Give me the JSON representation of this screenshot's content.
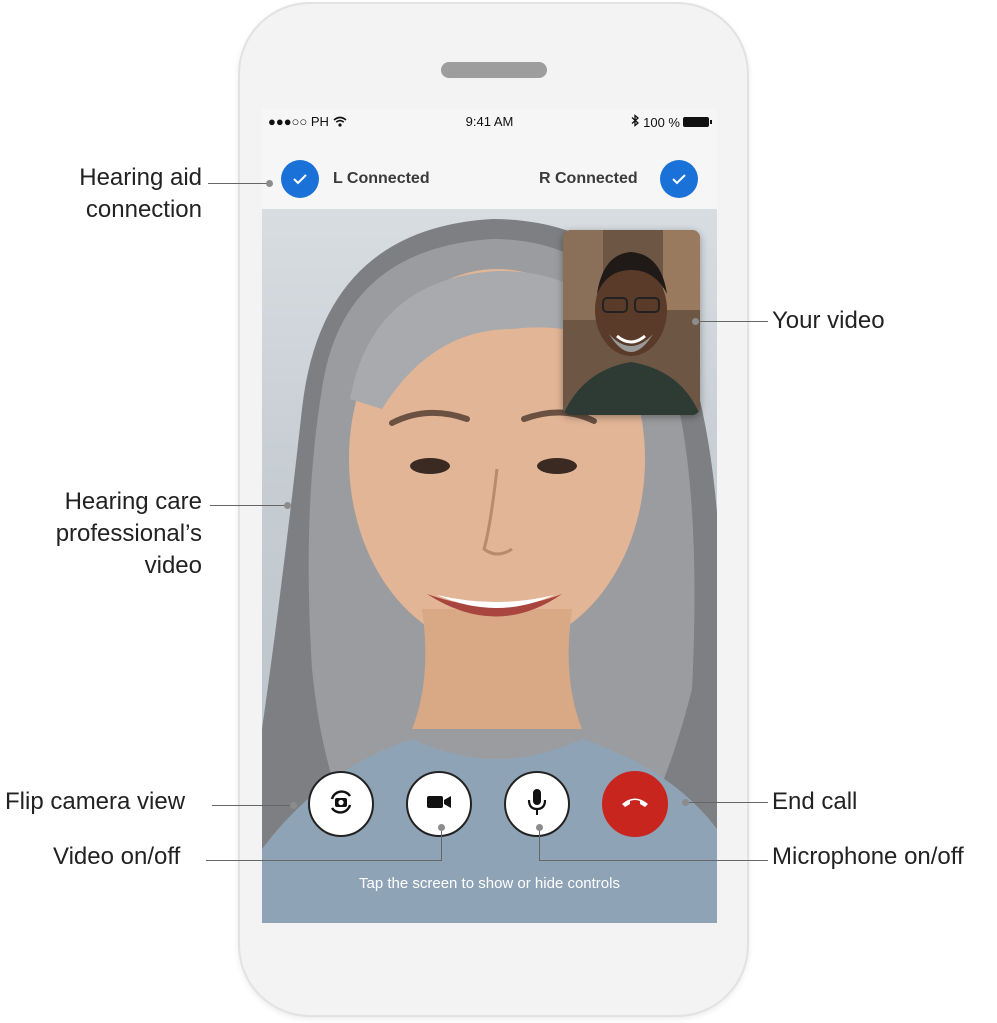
{
  "status_bar": {
    "carrier": "●●●○○ PH",
    "wifi_icon": "wifi-icon",
    "time": "9:41 AM",
    "bluetooth_icon": "bluetooth-icon",
    "battery": "100 %"
  },
  "connection": {
    "left_label": "L Connected",
    "right_label": "R Connected",
    "check_icon": "✓",
    "accent_color": "#1a72d8"
  },
  "controls": {
    "flip_icon": "flip-camera-icon",
    "video_icon": "video-camera-icon",
    "mic_icon": "microphone-icon",
    "end_icon": "end-call-icon",
    "end_color": "#c8251f",
    "hint": "Tap the screen to show or hide controls"
  },
  "callouts": {
    "hearing_aid_line1": "Hearing aid",
    "hearing_aid_line2": "connection",
    "your_video": "Your video",
    "pro_line1": "Hearing care",
    "pro_line2": "professional’s",
    "pro_line3": "video",
    "flip": "Flip camera view",
    "video": "Video on/off",
    "end": "End call",
    "mic": "Microphone on/off"
  }
}
